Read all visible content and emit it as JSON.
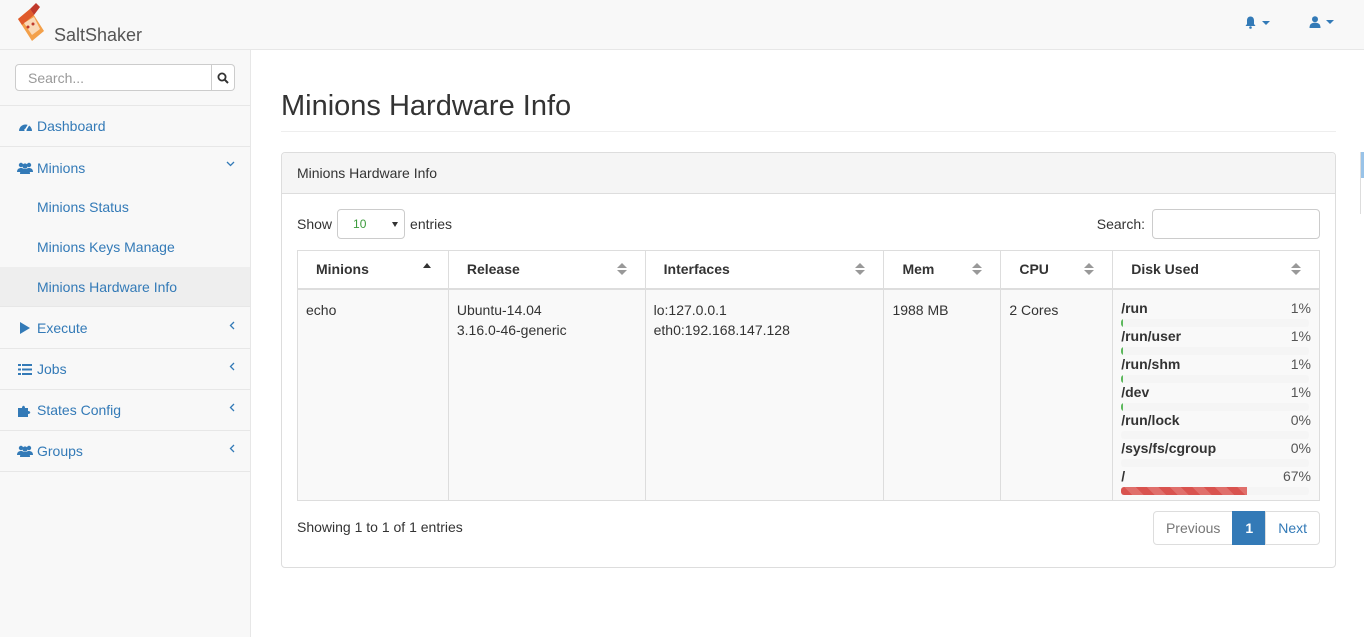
{
  "app": {
    "name": "SaltShaker"
  },
  "topbar": {
    "bell_icon": "bell-icon",
    "user_icon": "user-icon"
  },
  "sidebar": {
    "search_placeholder": "Search...",
    "items": [
      {
        "label": "Dashboard",
        "icon": "dashboard-icon"
      },
      {
        "label": "Minions",
        "icon": "users-icon"
      },
      {
        "label": "Execute",
        "icon": "play-icon"
      },
      {
        "label": "Jobs",
        "icon": "list-icon"
      },
      {
        "label": "States Config",
        "icon": "puzzle-icon"
      },
      {
        "label": "Groups",
        "icon": "users-icon"
      }
    ],
    "minions_sub": [
      {
        "label": "Minions Status"
      },
      {
        "label": "Minions Keys Manage"
      },
      {
        "label": "Minions Hardware Info",
        "active": true
      }
    ]
  },
  "main": {
    "title": "Minions Hardware Info",
    "panel_title": "Minions Hardware Info",
    "show_label": "Show",
    "entries_value": "10",
    "entries_label": "entries",
    "search_label": "Search:",
    "columns": [
      "Minions",
      "Release",
      "Interfaces",
      "Mem",
      "CPU",
      "Disk Used"
    ],
    "rows": [
      {
        "minion": "echo",
        "release": [
          "Ubuntu-14.04",
          "3.16.0-46-generic"
        ],
        "interfaces": [
          "lo:127.0.0.1",
          "eth0:192.168.147.128"
        ],
        "mem": "1988 MB",
        "cpu": "2 Cores",
        "disks": [
          {
            "mount": "/run",
            "percent": "1%",
            "value": 1
          },
          {
            "mount": "/run/user",
            "percent": "1%",
            "value": 1
          },
          {
            "mount": "/run/shm",
            "percent": "1%",
            "value": 1
          },
          {
            "mount": "/dev",
            "percent": "1%",
            "value": 1
          },
          {
            "mount": "/run/lock",
            "percent": "0%",
            "value": 0
          },
          {
            "mount": "/sys/fs/cgroup",
            "percent": "0%",
            "value": 0
          },
          {
            "mount": "/",
            "percent": "67%",
            "value": 67
          }
        ]
      }
    ],
    "info": "Showing 1 to 1 of 1 entries",
    "pager": {
      "previous": "Previous",
      "current": "1",
      "next": "Next"
    }
  },
  "colors": {
    "link": "#337ab7",
    "danger": "#d9534f",
    "success": "#5cb85c"
  }
}
